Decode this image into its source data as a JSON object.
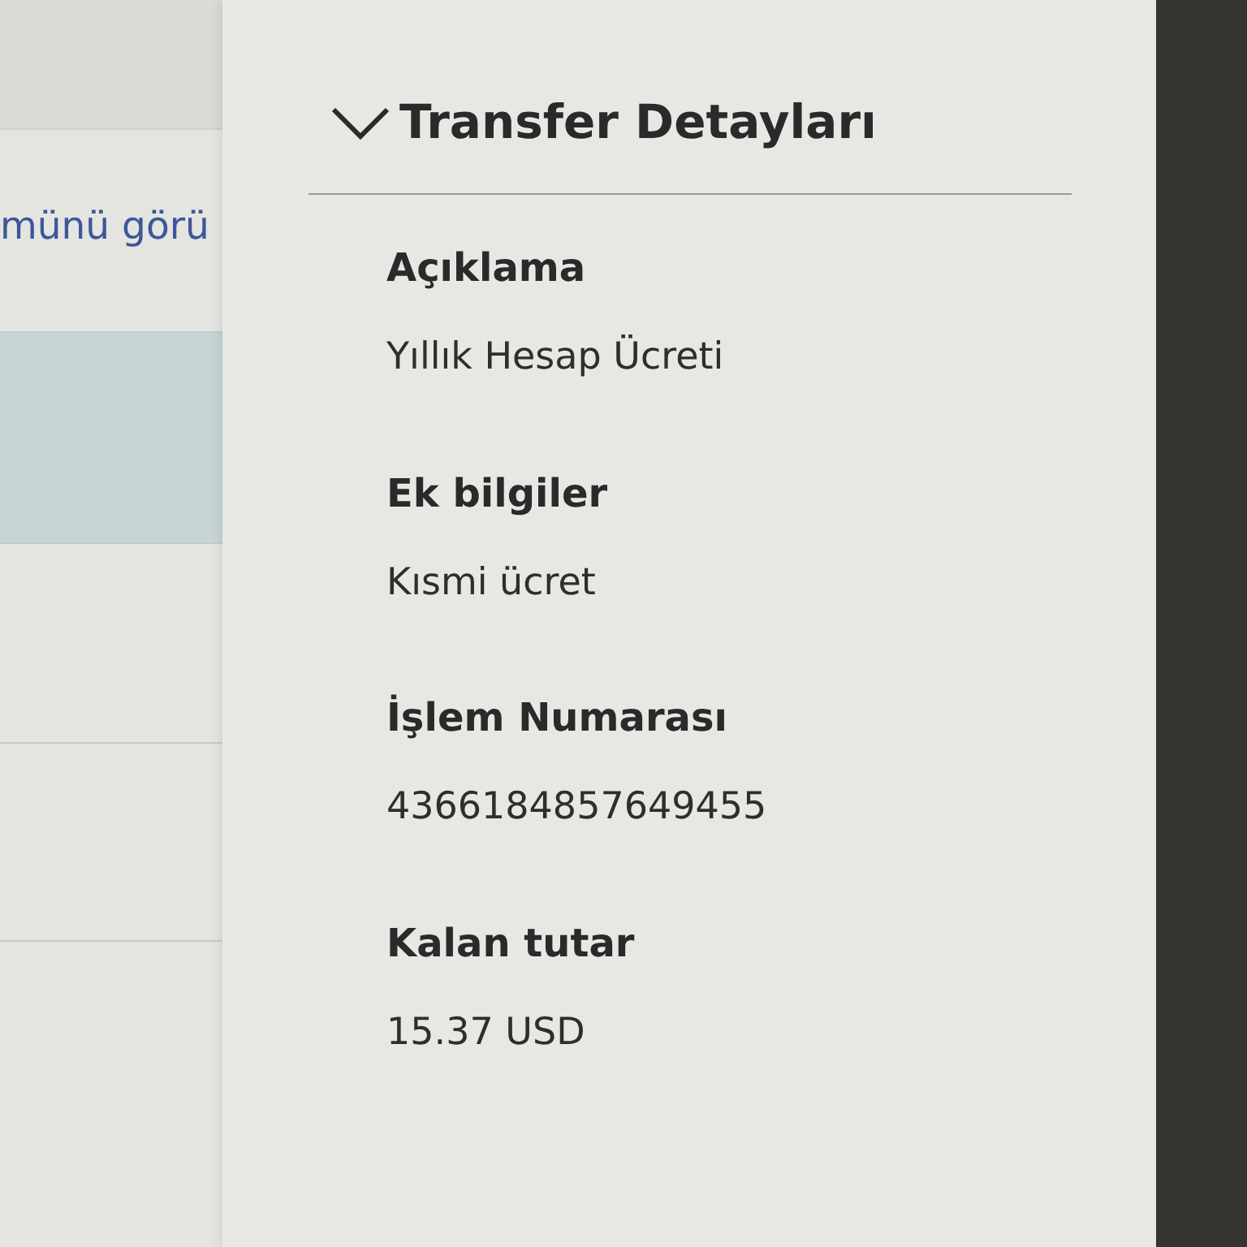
{
  "background_list": {
    "rows": [
      {
        "link": "münü görü",
        "selected": false
      },
      {
        "selected": true
      },
      {
        "selected": false
      },
      {
        "selected": false
      }
    ]
  },
  "details_panel": {
    "title": "Transfer Detayları",
    "expanded": true,
    "fields": [
      {
        "label": "Açıklama",
        "value": "Yıllık Hesap Ücreti"
      },
      {
        "label": "Ek bilgiler",
        "value": "Kısmi ücret"
      },
      {
        "label": "İşlem Numarası",
        "value": "4366184857649455"
      },
      {
        "label": "Kalan tutar",
        "value": "15.37 USD"
      }
    ]
  }
}
